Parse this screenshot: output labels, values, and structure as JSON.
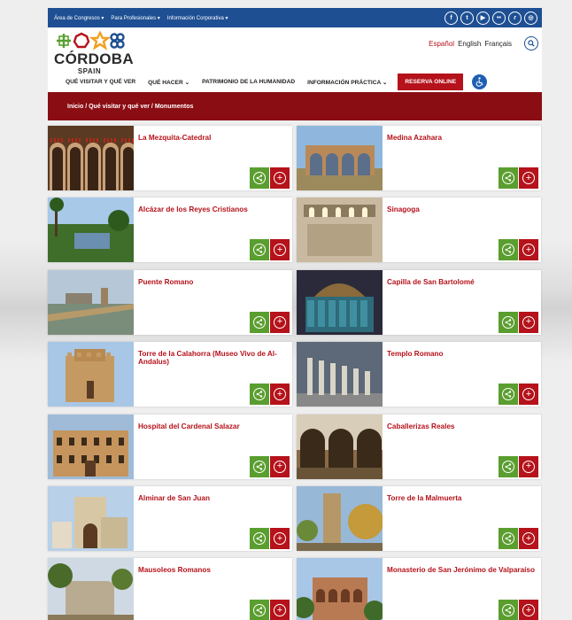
{
  "topbar": {
    "nav": [
      "Área de Congresos",
      "Para Profesionales",
      "Información Corporativa"
    ],
    "socials": [
      {
        "icon": "facebook-icon",
        "glyph": "f"
      },
      {
        "icon": "twitter-icon",
        "glyph": "t"
      },
      {
        "icon": "youtube-icon",
        "glyph": "▶"
      },
      {
        "icon": "flickr-icon",
        "glyph": "••"
      },
      {
        "icon": "rss-icon",
        "glyph": "ɾ"
      },
      {
        "icon": "instagram-icon",
        "glyph": "◎"
      }
    ]
  },
  "header": {
    "logo_city": "CÓRDOBA",
    "logo_country": "SPAIN",
    "languages": [
      {
        "label": "Español",
        "active": true
      },
      {
        "label": "English",
        "active": false
      },
      {
        "label": "Français",
        "active": false
      }
    ]
  },
  "nav": {
    "items": [
      "QUÉ VISITAR Y QUÉ VER",
      "QUÉ HACER",
      "PATRIMONIO DE LA HUMANIDAD",
      "INFORMACIÓN PRÁCTICA"
    ],
    "reserve": "RESERVA ONLINE"
  },
  "breadcrumb": "Inicio / Qué visitar y qué ver / Monumentos",
  "colors": {
    "brand_red": "#b5121b",
    "dark_red": "#8b0d14",
    "blue": "#1e4f93",
    "green": "#5a9e2f"
  },
  "monuments": [
    {
      "title": "La Mezquita-Catedral",
      "thumb": "arches"
    },
    {
      "title": "Medina Azahara",
      "thumb": "ruins"
    },
    {
      "title": "Alcázar de los Reyes Cristianos",
      "thumb": "garden"
    },
    {
      "title": "Sinagoga",
      "thumb": "interior"
    },
    {
      "title": "Puente Romano",
      "thumb": "bridge"
    },
    {
      "title": "Capilla de San Bartolomé",
      "thumb": "chapel"
    },
    {
      "title": "Torre de la Calahorra (Museo Vivo de Al-Andalus)",
      "thumb": "tower"
    },
    {
      "title": "Templo Romano",
      "thumb": "columns"
    },
    {
      "title": "Hospital del Cardenal Salazar",
      "thumb": "facade"
    },
    {
      "title": "Caballerizas Reales",
      "thumb": "stables"
    },
    {
      "title": "Alminar de San Juan",
      "thumb": "minaret"
    },
    {
      "title": "Torre de la Malmuerta",
      "thumb": "malmuerta"
    },
    {
      "title": "Mausoleos Romanos",
      "thumb": "mausoleum"
    },
    {
      "title": "Monasterio de San Jerónimo de Valparaíso",
      "thumb": "monastery"
    }
  ]
}
